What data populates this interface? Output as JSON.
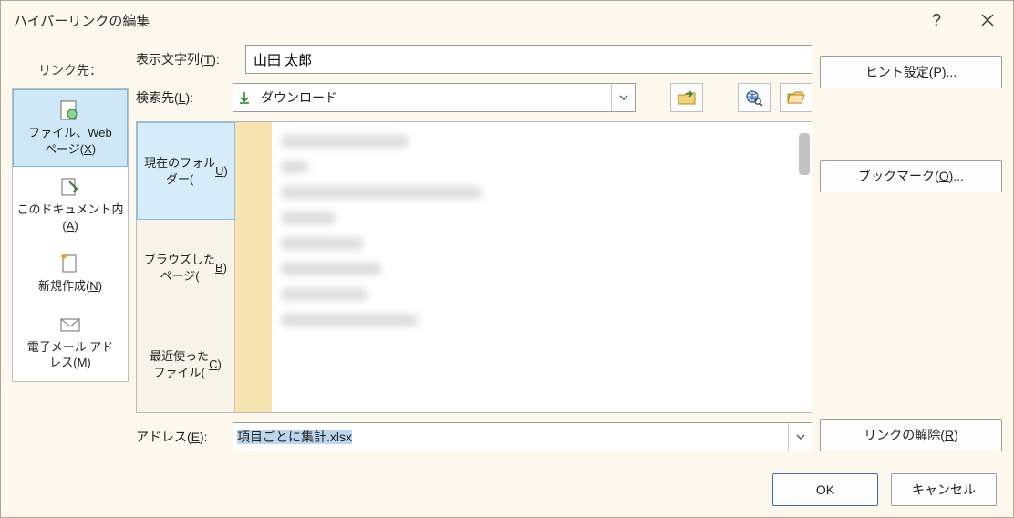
{
  "dialog": {
    "title": "ハイパーリンクの編集"
  },
  "link_to": {
    "label": "リンク先：",
    "items": [
      {
        "label": "ファイル、Web\nページ(X)",
        "icon": "file-web"
      },
      {
        "label": "このドキュメント内\n(A)",
        "icon": "this-doc"
      },
      {
        "label": "新規作成(N)",
        "icon": "new-doc"
      },
      {
        "label": "電子メール アド\nレス(M)",
        "icon": "email"
      }
    ],
    "selected_index": 0
  },
  "display_text": {
    "label": "表示文字列(T):",
    "value": "山田 太郎"
  },
  "lookin": {
    "label": "検索先(L):",
    "value": "ダウンロード"
  },
  "browse_tabs": {
    "items": [
      "現在のフォル\nダー(U)",
      "ブラウズした\nページ(B)",
      "最近使った\nファイル(C)"
    ],
    "selected_index": 0
  },
  "address": {
    "label": "アドレス(E):",
    "value": "項目ごとに集計.xlsx"
  },
  "buttons": {
    "screentip": "ヒント設定(P)...",
    "bookmark": "ブックマーク(O)...",
    "remove_link": "リンクの解除(R)",
    "ok": "OK",
    "cancel": "キャンセル"
  },
  "chart_data": null
}
